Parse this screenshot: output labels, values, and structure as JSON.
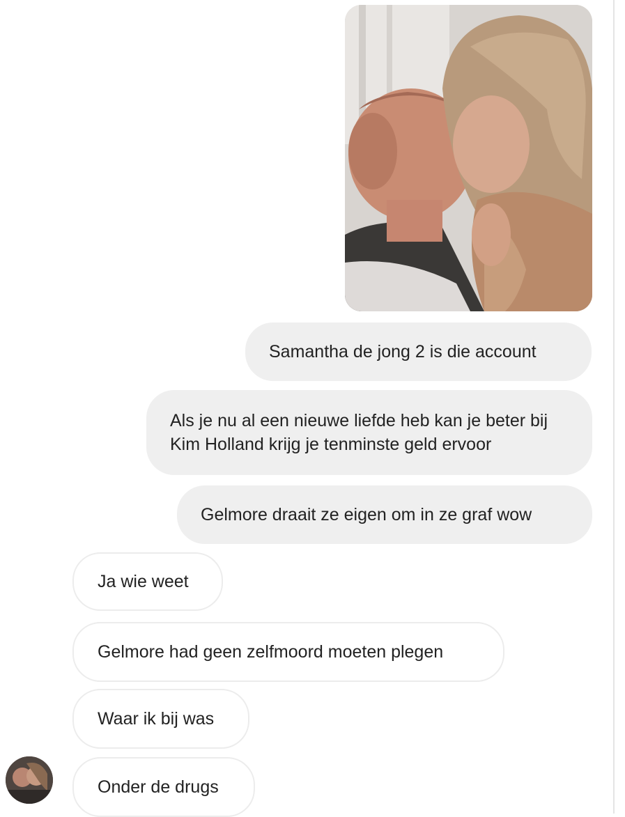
{
  "messages": {
    "sent": [
      {
        "text": "Samantha de jong 2 is die account"
      },
      {
        "text": "Als je nu al een nieuwe liefde heb kan je beter bij Kim Holland krijg je tenminste geld ervoor"
      },
      {
        "text": "Gelmore draait ze eigen om in ze graf wow"
      }
    ],
    "received": [
      {
        "text": "Ja wie weet"
      },
      {
        "text": "Gelmore had geen zelfmoord moeten plegen"
      },
      {
        "text": "Waar ik bij was"
      },
      {
        "text": "Onder de drugs"
      }
    ]
  },
  "colors": {
    "sent_bubble": "#efefef",
    "received_bubble_border": "#ececec",
    "text": "#222222",
    "background": "#ffffff"
  }
}
